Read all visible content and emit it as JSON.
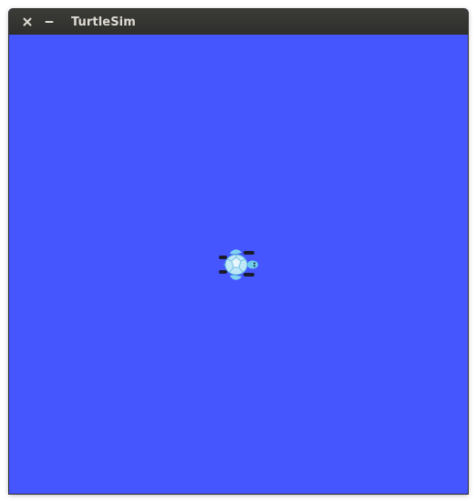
{
  "window": {
    "title": "TurtleSim",
    "close_icon": "close-icon",
    "minimize_icon": "minimize-icon"
  },
  "canvas": {
    "background_color": "#4556ff",
    "turtle_icon": "turtle-icon"
  }
}
